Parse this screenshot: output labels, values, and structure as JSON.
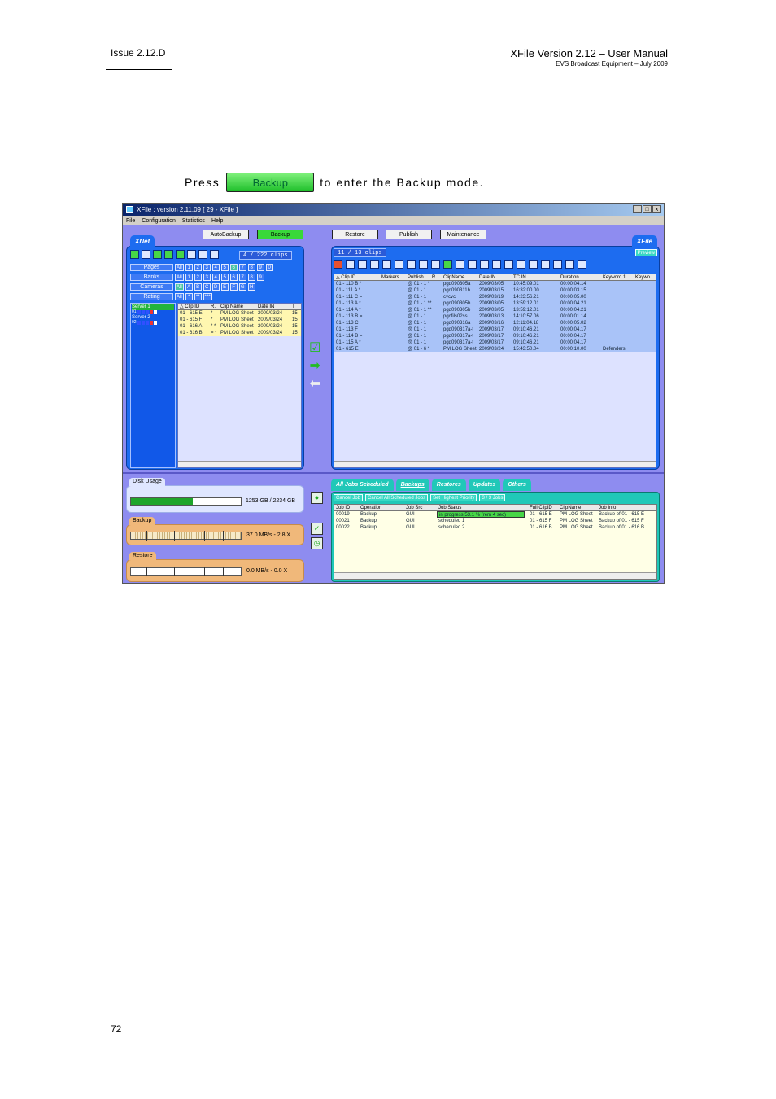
{
  "header": {
    "issue": "Issue 2.12.D",
    "title": "XFile Version 2.12 – User Manual",
    "subtitle": "EVS Broadcast Equipment – July 2009"
  },
  "instruction": {
    "before": "Press",
    "button": "Backup",
    "after": "to enter the Backup mode."
  },
  "footer": {
    "page": "72"
  },
  "app": {
    "title": "XFile : version 2.11.09 [ 29 - XFile ]",
    "window_buttons": [
      "_",
      "□",
      "x"
    ],
    "menu": [
      "File",
      "Configuration",
      "Statistics",
      "Help"
    ],
    "modes": {
      "autobackup": "AutoBackup",
      "backup": "Backup",
      "restore": "Restore",
      "publish": "Publish",
      "maintenance": "Maintenance"
    },
    "xnet": {
      "tag": "XNet",
      "clip_count": "4 / 222 clips",
      "filters": [
        {
          "label": "Pages",
          "boxes": [
            "All",
            "1",
            "2",
            "3",
            "4",
            "5",
            "6",
            "7",
            "8",
            "9",
            "0"
          ]
        },
        {
          "label": "Banks",
          "boxes": [
            "All",
            "1",
            "2",
            "3",
            "4",
            "5",
            "6",
            "7",
            "8",
            "9"
          ]
        },
        {
          "label": "Cameras",
          "boxes": [
            "All",
            "A",
            "B",
            "C",
            "D",
            "E",
            "F",
            "G",
            "H"
          ]
        },
        {
          "label": "Rating",
          "boxes": [
            "All",
            "*",
            "**",
            "***"
          ]
        }
      ],
      "servers": [
        "Server 1",
        "01",
        "Server 2",
        "02"
      ],
      "columns": [
        "△ Clip ID",
        "R.",
        "Clip Name",
        "Date IN",
        "T"
      ],
      "rows": [
        [
          "01 - 615 E",
          "*",
          "PM LOG Sheet",
          "2009/03/24",
          "15"
        ],
        [
          "01 - 615 F",
          "*",
          "PM LOG Sheet",
          "2009/03/24",
          "15"
        ],
        [
          "01 - 616 A",
          "* *",
          "PM LOG Sheet",
          "2009/03/24",
          "15"
        ],
        [
          "01 - 616 B",
          "= *",
          "PM LOG Sheet",
          "2009/03/24",
          "15"
        ]
      ]
    },
    "xfile": {
      "tag": "XFile",
      "preview": "Preview",
      "clip_count": "11 / 13 clips",
      "columns": [
        "△ Clip ID",
        "Markers",
        "Publish",
        "R.",
        "ClipName",
        "Date IN",
        "TC IN",
        "Duration",
        "Keyword 1",
        "Keywo"
      ],
      "rows": [
        [
          "01 - 110 B *",
          "",
          "@ 01 - 1 *",
          "",
          "pgd090305a",
          "2009/03/05",
          "10:45:09.01",
          "00:00:04.14",
          ""
        ],
        [
          "01 - 111 A *",
          "",
          "@ 01 - 1",
          "",
          "pgd090311h",
          "2009/03/15",
          "16:32:00.00",
          "00:00:03.15",
          ""
        ],
        [
          "01 - 111 C =",
          "",
          "@ 01 - 1",
          "",
          "cvcvc",
          "2009/03/19",
          "14:23:56.21",
          "00:00:05.00",
          ""
        ],
        [
          "01 - 113 A *",
          "",
          "@ 01 - 1 **",
          "",
          "pgd090305b",
          "2009/03/05",
          "13:59:12.01",
          "00:00:04.21",
          ""
        ],
        [
          "01 - 114 A *",
          "",
          "@ 01 - 1 **",
          "",
          "pgd090305b",
          "2009/03/05",
          "13:59:12.01",
          "00:00:04.21",
          ""
        ],
        [
          "01 - 113 B =",
          "",
          "@ 01 - 1",
          "",
          "pgcfils02ss",
          "2009/03/13",
          "14:10:57.06",
          "00:00:01.14",
          ""
        ],
        [
          "01 - 113 C",
          "",
          "@ 01 - 1",
          "",
          "pgd090316a",
          "2009/03/16",
          "12:11:04.18",
          "00:00:05.02",
          ""
        ],
        [
          "01 - 113 F",
          "",
          "@ 01 - 1",
          "",
          "pgd090317a-t",
          "2009/03/17",
          "09:10:46.21",
          "00:00:04.17",
          ""
        ],
        [
          "01 - 114 B =",
          "",
          "@ 01 - 1",
          "",
          "pgd090317a-t",
          "2009/03/17",
          "09:10:46.21",
          "00:00:04.17",
          ""
        ],
        [
          "01 - 115 A *",
          "",
          "@ 01 - 1",
          "",
          "pgd090317a-t",
          "2009/03/17",
          "09:10:46.21",
          "00:00:04.17",
          ""
        ],
        [
          "01 - 615 E",
          "",
          "@ 01 - 6 *",
          "",
          "PM LOG Sheet",
          "2009/03/24",
          "15:43:50.04",
          "00:00:10.00",
          "Defenders"
        ]
      ]
    },
    "disk": {
      "label": "Disk Usage",
      "value": "1253 GB / 2234 GB",
      "used_fraction": 0.56
    },
    "backup_gauge": {
      "label": "Backup",
      "value": "37.0 MB/s - 2.8 X"
    },
    "restore_gauge": {
      "label": "Restore",
      "value": "0.0 MB/s - 0.0 X"
    },
    "jobs": {
      "tabs": [
        "All Jobs Scheduled",
        "Backups",
        "Restores",
        "Updates",
        "Others"
      ],
      "actions": [
        "Cancel Job",
        "Cancel All Scheduled Jobs",
        "Set Highest Priority",
        "3 / 3 Jobs"
      ],
      "columns": [
        "Job ID",
        "Operation",
        "Job Src",
        "Job Status",
        "Full ClipID",
        "ClipName",
        "Job Info"
      ],
      "rows": [
        [
          "00019",
          "Backup",
          "GUI",
          "in progress 53.1 % (rem 4 sec)",
          "01 - 615 E",
          "PM LOG Sheet",
          "Backup of 01 - 615 E"
        ],
        [
          "00021",
          "Backup",
          "GUI",
          "scheduled 1",
          "01 - 615 F",
          "PM LOG Sheet",
          "Backup of 01 - 615 F"
        ],
        [
          "00022",
          "Backup",
          "GUI",
          "scheduled 2",
          "01 - 616 B",
          "PM LOG Sheet",
          "Backup of 01 - 616 B"
        ]
      ]
    }
  }
}
